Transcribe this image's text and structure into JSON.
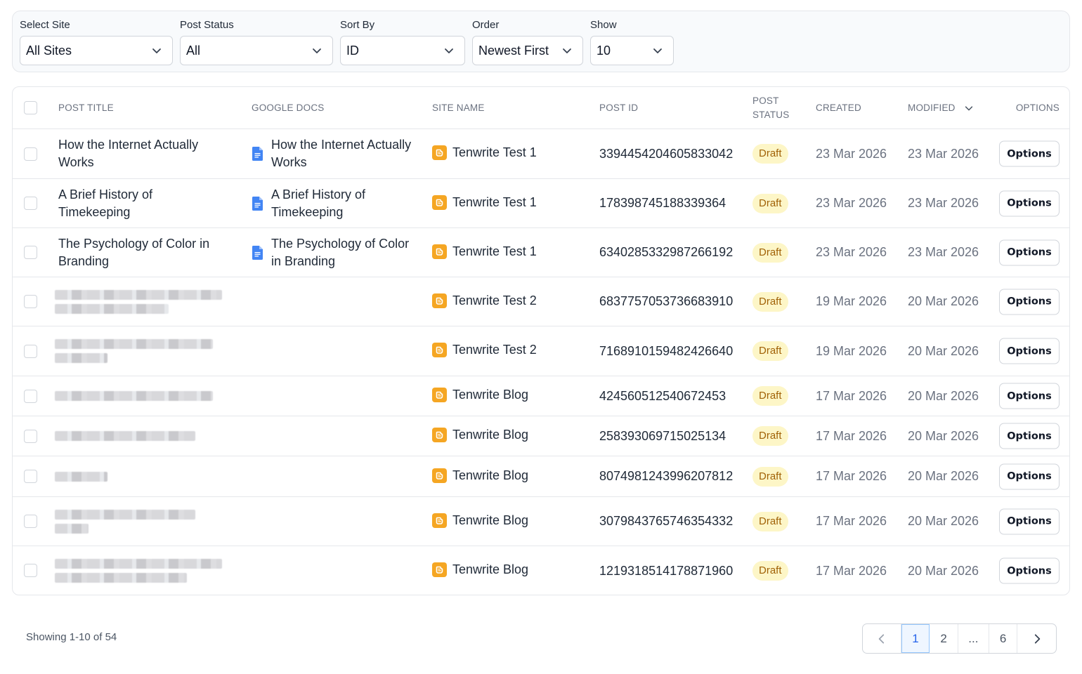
{
  "filters": [
    {
      "label": "Select Site",
      "value": "All Sites"
    },
    {
      "label": "Post Status",
      "value": "All"
    },
    {
      "label": "Sort By",
      "value": "ID"
    },
    {
      "label": "Order",
      "value": "Newest First"
    },
    {
      "label": "Show",
      "value": "10"
    }
  ],
  "table": {
    "headers": {
      "post_title": "POST TITLE",
      "google_docs": "GOOGLE DOCS",
      "site_name": "SITE NAME",
      "post_id": "POST ID",
      "post_status_1": "POST",
      "post_status_2": "STATUS",
      "created": "CREATED",
      "modified": "MODIFIED",
      "options": "OPTIONS"
    },
    "rows": [
      {
        "title": "How the Internet Actually Works",
        "doc": "How the Internet Actually Works",
        "site": "Tenwrite Test 1",
        "post_id": "3394454204605833042",
        "status": "Draft",
        "created": "23 Mar 2026",
        "modified": "23 Mar 2026",
        "options": "Options"
      },
      {
        "title": "A Brief History of Timekeeping",
        "doc": "A Brief History of Timekeeping",
        "site": "Tenwrite Test 1",
        "post_id": "178398745188339364",
        "status": "Draft",
        "created": "23 Mar 2026",
        "modified": "23 Mar 2026",
        "options": "Options"
      },
      {
        "title": "The Psychology of Color in Branding",
        "doc": "The Psychology of Color in Branding",
        "site": "Tenwrite Test 1",
        "post_id": "6340285332987266192",
        "status": "Draft",
        "created": "23 Mar 2026",
        "modified": "23 Mar 2026",
        "options": "Options"
      },
      {
        "title": "",
        "doc": "",
        "site": "Tenwrite Test 2",
        "post_id": "6837757053736683910",
        "status": "Draft",
        "created": "19 Mar 2026",
        "modified": "20 Mar 2026",
        "options": "Options"
      },
      {
        "title": "",
        "doc": "",
        "site": "Tenwrite Test 2",
        "post_id": "7168910159482426640",
        "status": "Draft",
        "created": "19 Mar 2026",
        "modified": "20 Mar 2026",
        "options": "Options"
      },
      {
        "title": "",
        "doc": "",
        "site": "Tenwrite Blog",
        "post_id": "424560512540672453",
        "status": "Draft",
        "created": "17 Mar 2026",
        "modified": "20 Mar 2026",
        "options": "Options"
      },
      {
        "title": "",
        "doc": "",
        "site": "Tenwrite Blog",
        "post_id": "258393069715025134",
        "status": "Draft",
        "created": "17 Mar 2026",
        "modified": "20 Mar 2026",
        "options": "Options"
      },
      {
        "title": "",
        "doc": "",
        "site": "Tenwrite Blog",
        "post_id": "8074981243996207812",
        "status": "Draft",
        "created": "17 Mar 2026",
        "modified": "20 Mar 2026",
        "options": "Options"
      },
      {
        "title": "",
        "doc": "",
        "site": "Tenwrite Blog",
        "post_id": "3079843765746354332",
        "status": "Draft",
        "created": "17 Mar 2026",
        "modified": "20 Mar 2026",
        "options": "Options"
      },
      {
        "title": "",
        "doc": "",
        "site": "Tenwrite Blog",
        "post_id": "1219318514178871960",
        "status": "Draft",
        "created": "17 Mar 2026",
        "modified": "20 Mar 2026",
        "options": "Options"
      }
    ]
  },
  "footer": {
    "showing": "Showing 1-10 of 54",
    "pages": [
      "1",
      "2",
      "...",
      "6"
    ],
    "current_page": "1"
  },
  "colors": {
    "draft_badge_bg": "#fdf6c7",
    "draft_badge_text": "#a16207",
    "blogger_icon": "#f5a623",
    "docs_icon": "#4285f4",
    "active_page": "#2563eb"
  },
  "icons": [
    "chevron-down-icon",
    "google-docs-icon",
    "blogger-icon",
    "chevron-left-icon",
    "chevron-right-icon"
  ]
}
